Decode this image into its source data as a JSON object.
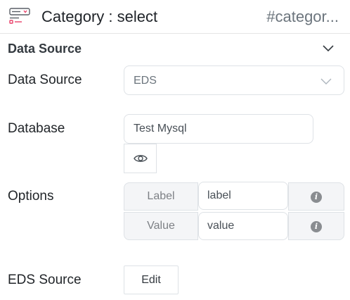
{
  "header": {
    "icon": "component-select-icon",
    "title": "Category : select",
    "component_id": "#categor..."
  },
  "section": {
    "title": "Data Source",
    "chevron_icon": "chevron-down-icon"
  },
  "fields": {
    "data_source": {
      "label": "Data Source",
      "value": "EDS"
    },
    "database": {
      "label": "Database",
      "value": "Test Mysql",
      "toggle_icon": "eye-icon"
    },
    "options": {
      "label": "Options",
      "rows": [
        {
          "key": "Label",
          "value": "label",
          "icon": "info-icon"
        },
        {
          "key": "Value",
          "value": "value",
          "icon": "info-icon"
        }
      ],
      "info_glyph": "i"
    },
    "eds_source": {
      "label": "EDS Source",
      "button_label": "Edit"
    }
  },
  "colors": {
    "icon_accent": "#e8416a",
    "border": "#dee2e6",
    "addon_bg": "#f4f5f7"
  }
}
